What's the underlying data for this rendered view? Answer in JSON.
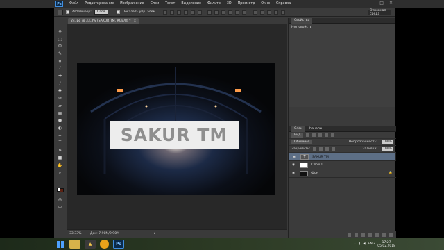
{
  "app": {
    "logo": "Ps"
  },
  "menu": [
    "Файл",
    "Редактирование",
    "Изображение",
    "Слои",
    "Текст",
    "Выделение",
    "Фильтр",
    "3D",
    "Просмотр",
    "Окно",
    "Справка"
  ],
  "window_controls": [
    "–",
    "□",
    "✕"
  ],
  "options": {
    "autoselect_label": "Автовыбор:",
    "autoselect_value": "Слой",
    "show_controls_label": "Показать упр. элем."
  },
  "workspace": {
    "value": "Основная среда"
  },
  "document": {
    "tab_title": "24.jpg @ 33,3% (SAKUR TM, RGB/8) *",
    "banner_text": "SAKUR TM"
  },
  "status": {
    "zoom": "33,33%",
    "doc": "Док: 7,90М/9,90М"
  },
  "properties": {
    "tab": "Свойства",
    "empty": "Нет свойств"
  },
  "layers_panel": {
    "tabs": [
      "Слои",
      "Каналы"
    ],
    "kind_label": "Вид",
    "blend_mode": "Обычные",
    "opacity_label": "Непрозрачность:",
    "opacity_value": "100%",
    "lock_label": "Закрепить:",
    "fill_label": "Заливка:",
    "fill_value": "100%",
    "layers": [
      {
        "name": "SAKUR TM",
        "selected": true
      },
      {
        "name": "Слой 1",
        "selected": false
      },
      {
        "name": "Фон",
        "selected": false
      }
    ]
  },
  "taskbar": {
    "lang": "ENG",
    "time": "17:27",
    "date": "05.02.2018"
  }
}
